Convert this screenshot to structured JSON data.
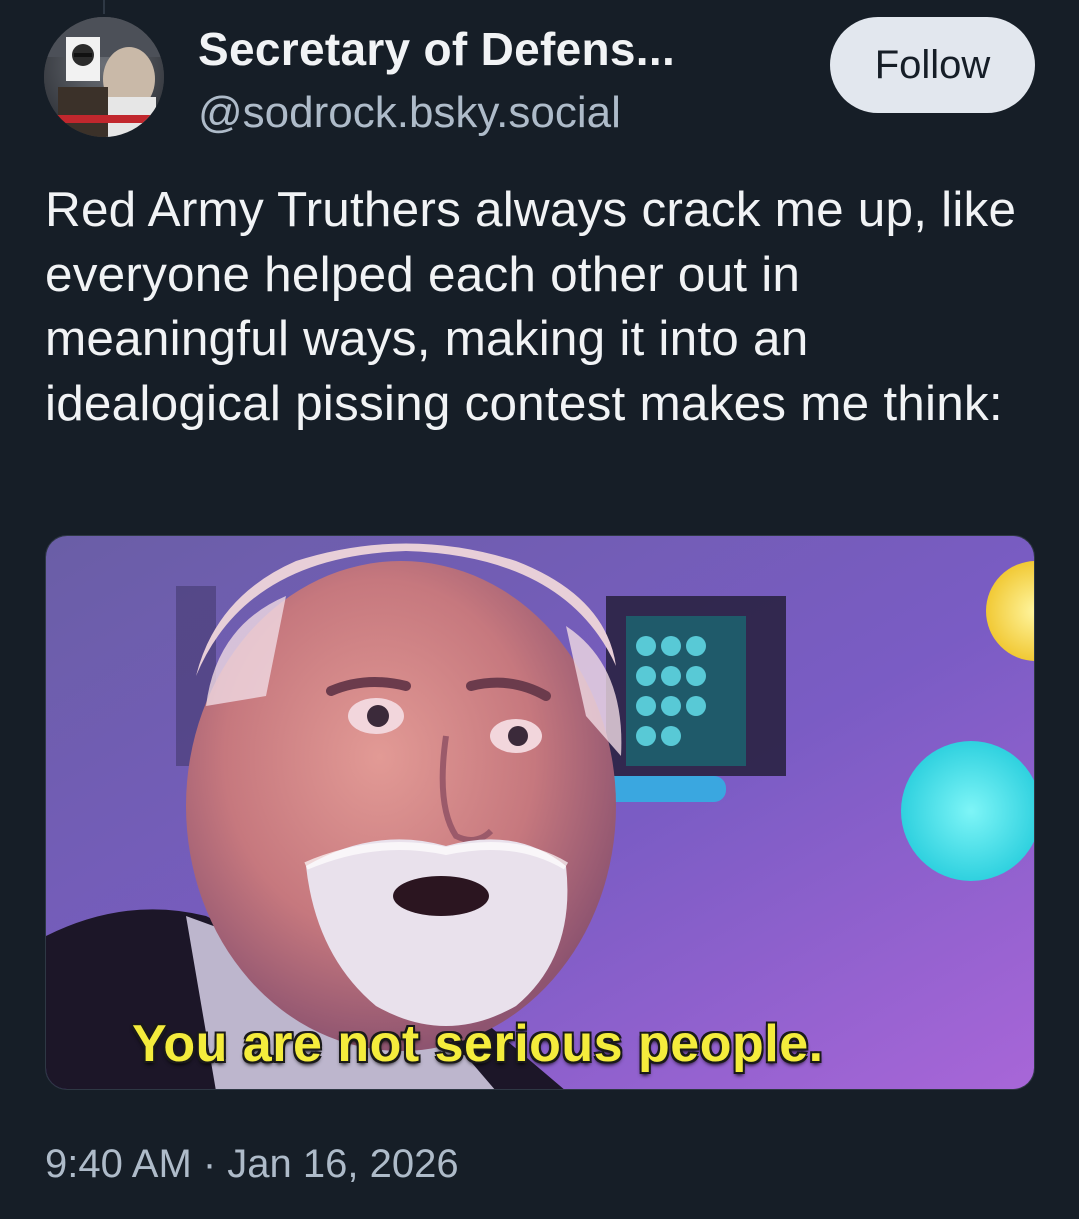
{
  "post": {
    "author": {
      "display_name": "Secretary of Defens...",
      "handle": "@sodrock.bsky.social"
    },
    "follow_label": "Follow",
    "text": "Red Army Truthers always crack me up, like everyone helped each other out in meaningful ways, making it into an idealogical pissing contest makes me think:",
    "image": {
      "caption": "You are not serious people."
    },
    "timestamp": "9:40 AM · Jan 16, 2026"
  },
  "colors": {
    "background": "#161e27",
    "text_primary": "#f1f3f5",
    "text_secondary": "#aebbc9",
    "follow_button_bg": "#e2e7ee",
    "caption_color": "#f4ec3c"
  }
}
